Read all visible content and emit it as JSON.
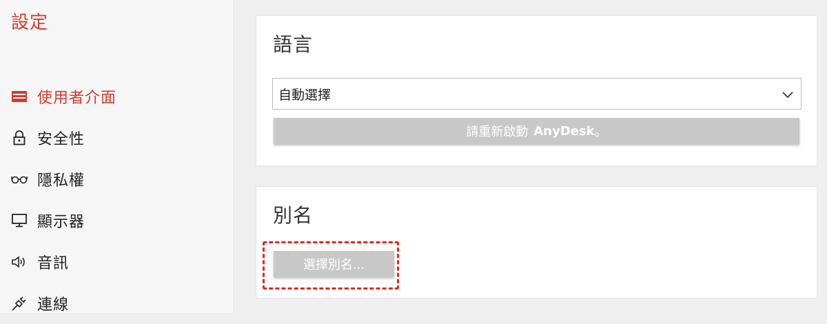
{
  "app": {
    "title": "設定"
  },
  "sidebar": {
    "items": [
      {
        "label": "使用者介面",
        "icon": "user-interface-icon",
        "active": true
      },
      {
        "label": "安全性",
        "icon": "lock-icon",
        "active": false
      },
      {
        "label": "隱私權",
        "icon": "glasses-icon",
        "active": false
      },
      {
        "label": "顯示器",
        "icon": "monitor-icon",
        "active": false
      },
      {
        "label": "音訊",
        "icon": "speaker-icon",
        "active": false
      },
      {
        "label": "連線",
        "icon": "plug-icon",
        "active": false
      }
    ]
  },
  "language": {
    "title": "語言",
    "select_value": "自動選擇",
    "restart_text": "請重新啟動",
    "restart_brand": "AnyDesk",
    "restart_suffix": "。"
  },
  "alias": {
    "title": "別名",
    "button_label": "選擇別名..."
  },
  "colors": {
    "accent": "#d43a2d",
    "disabled_button": "#c8c8c8",
    "highlight": "#e0281e"
  }
}
